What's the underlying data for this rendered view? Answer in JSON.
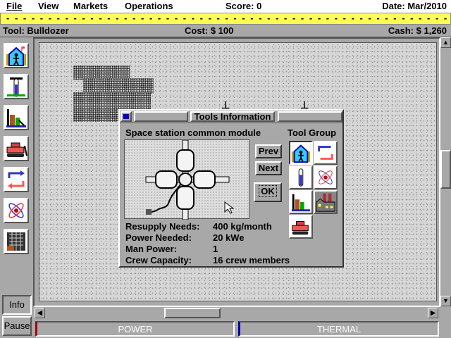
{
  "menu": {
    "file": "File",
    "view": "View",
    "markets": "Markets",
    "operations": "Operations",
    "score": "Score: 0",
    "date": "Date: Mar/2010"
  },
  "ticker": "- - - - - - - - - - - - - - - - - - - - - - - - - - - - - - - - - - - - - - - - - - - - - - - - - - - - -",
  "status": {
    "tool": "Tool: Bulldozer",
    "cost": "Cost: $ 100",
    "cash": "Cash: $ 1,260"
  },
  "sidebar": {
    "info": "Info",
    "pause": "Pause"
  },
  "meters": {
    "power": "POWER",
    "thermal": "THERMAL",
    "power_color": "#aa0000",
    "thermal_color": "#0000aa"
  },
  "dialog": {
    "title": "Tools Information",
    "item_name": "Space station common module",
    "tool_group": "Tool Group",
    "prev": "Prev",
    "next": "Next",
    "ok": "OK",
    "stats": [
      {
        "label": "Resupply Needs:",
        "value": "400 kg/month"
      },
      {
        "label": "Power Needed:",
        "value": "20 kWe"
      },
      {
        "label": "Man Power:",
        "value": "1"
      },
      {
        "label": "Crew Capacity:",
        "value": "16 crew members"
      }
    ]
  }
}
